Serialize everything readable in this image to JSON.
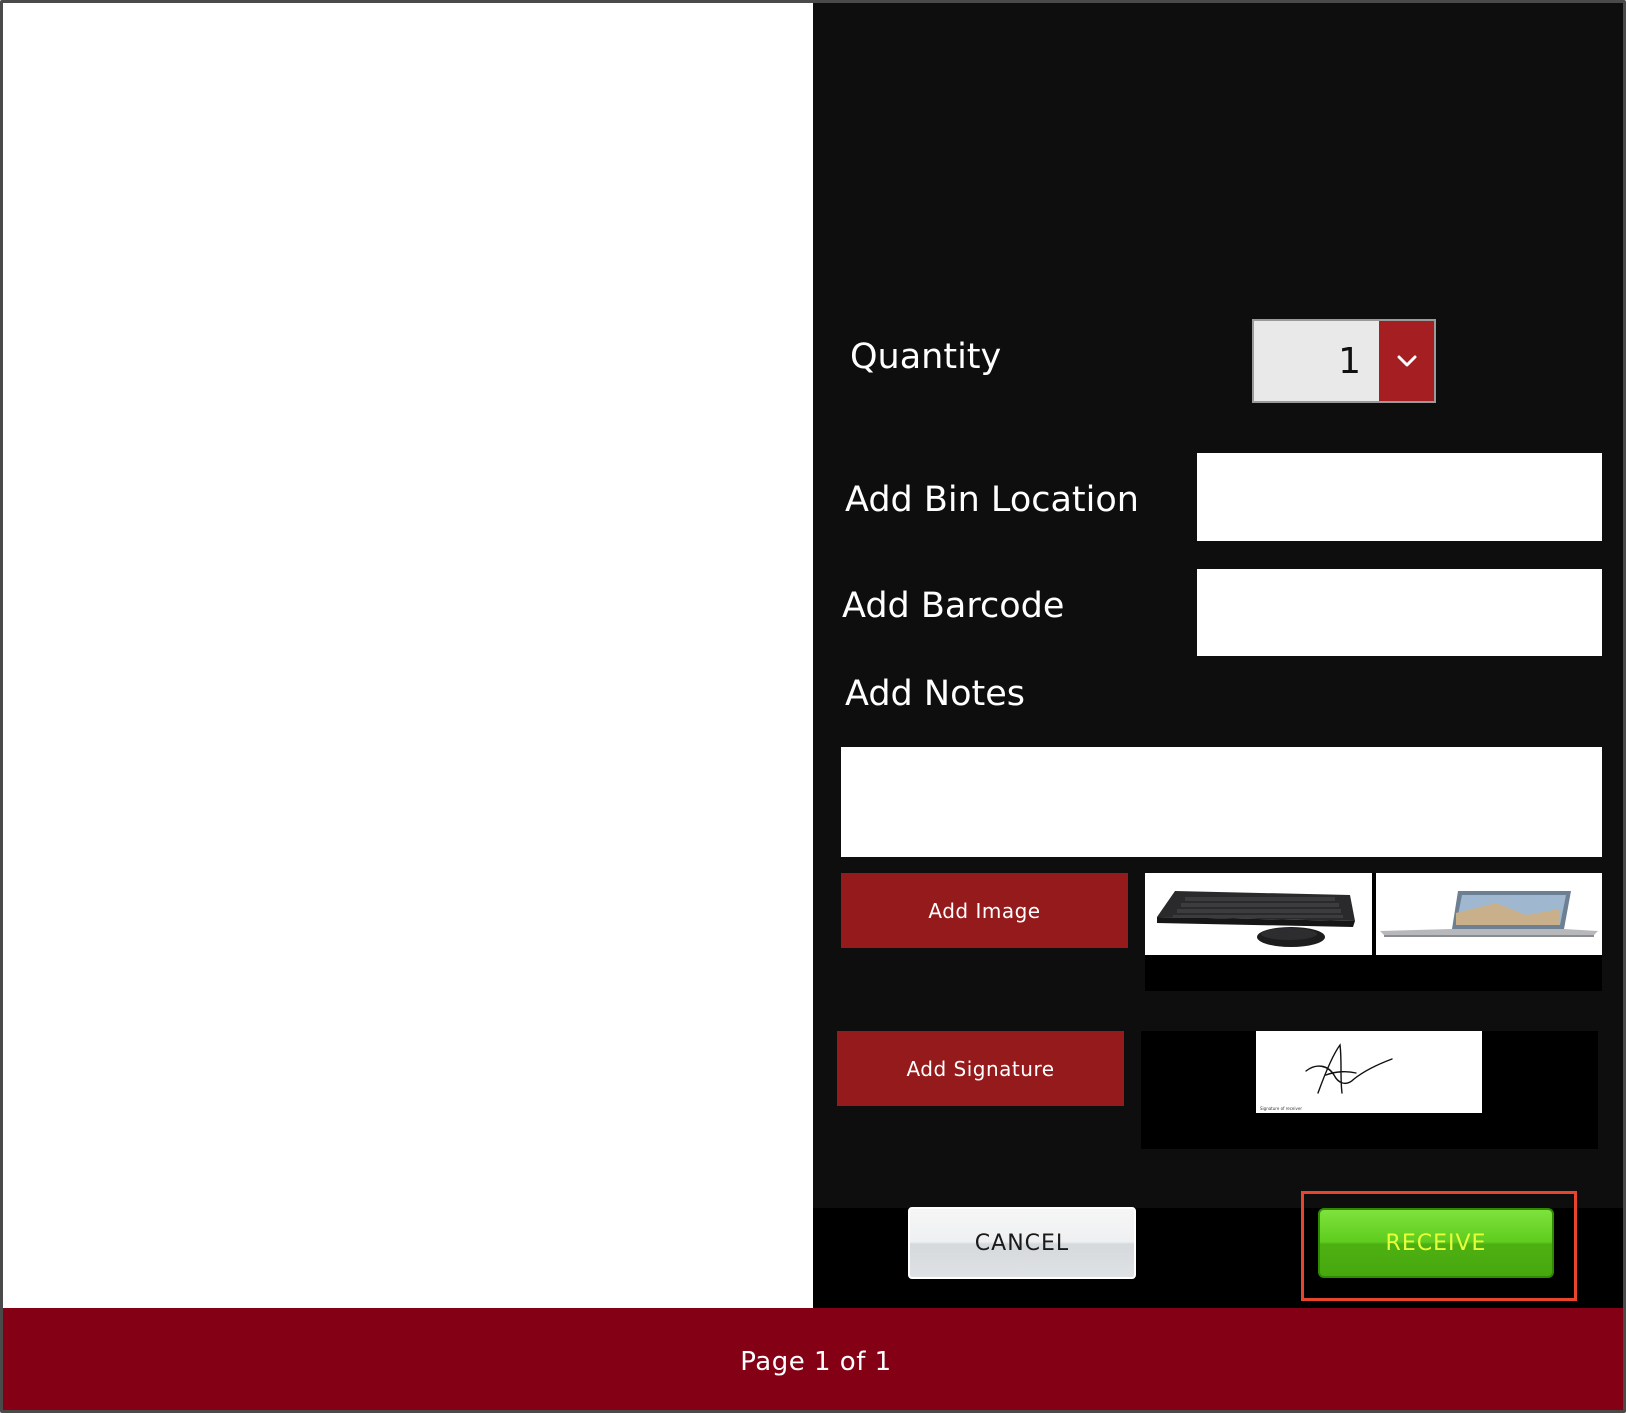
{
  "form": {
    "quantity_label": "Quantity",
    "quantity_value": "1",
    "bin_location_label": "Add Bin Location",
    "bin_location_value": "",
    "barcode_label": "Add Barcode",
    "barcode_value": "",
    "notes_label": "Add Notes",
    "notes_value": "",
    "add_image_label": "Add Image",
    "add_signature_label": "Add Signature",
    "signature_caption": "Signature of receiver"
  },
  "images": [
    {
      "name": "keyboard-mouse-image"
    },
    {
      "name": "laptop-image"
    }
  ],
  "actions": {
    "cancel_label": "CANCEL",
    "receive_label": "RECEIVE"
  },
  "footer": {
    "pagination": "Page 1 of 1"
  },
  "colors": {
    "panel": "#0e0e0e",
    "accent_red": "#951a1b",
    "footer_red": "#840014",
    "receive_green": "#5fcc1f",
    "highlight": "#e8442e"
  }
}
